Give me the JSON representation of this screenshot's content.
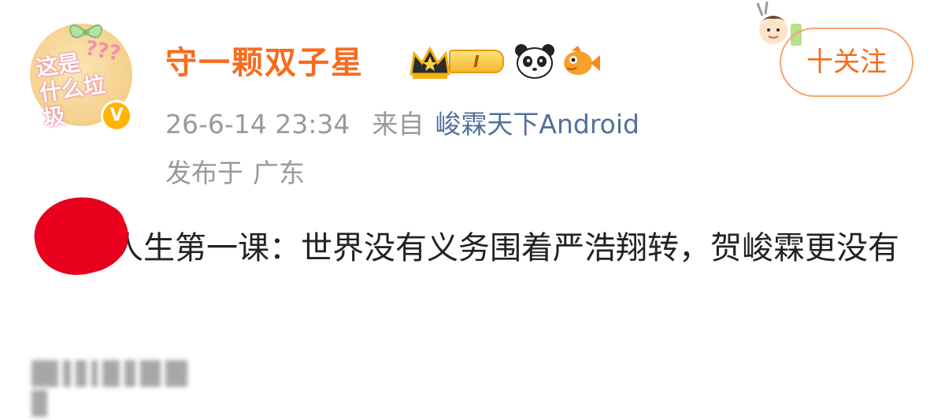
{
  "post": {
    "author": {
      "username": "守一颗双子星",
      "level": "I",
      "verified_icon": "verified-v-icon",
      "badges": [
        "crown-icon",
        "level-badge",
        "panda-icon",
        "fish-icon"
      ]
    },
    "timestamp": "26-6-14 23:34",
    "from_label": "来自",
    "source": "峻霖天下Android",
    "location_label": "发布于",
    "location": "广东",
    "follow_label": "十关注",
    "content": "人生第一课：世界没有义务围着严浩翔转，贺峻霖更没有"
  },
  "colors": {
    "username": "#f86b1d",
    "meta_text": "#999999",
    "source_link": "#52709c",
    "follow_border": "#f8a46e",
    "redaction": "#e8001c"
  }
}
